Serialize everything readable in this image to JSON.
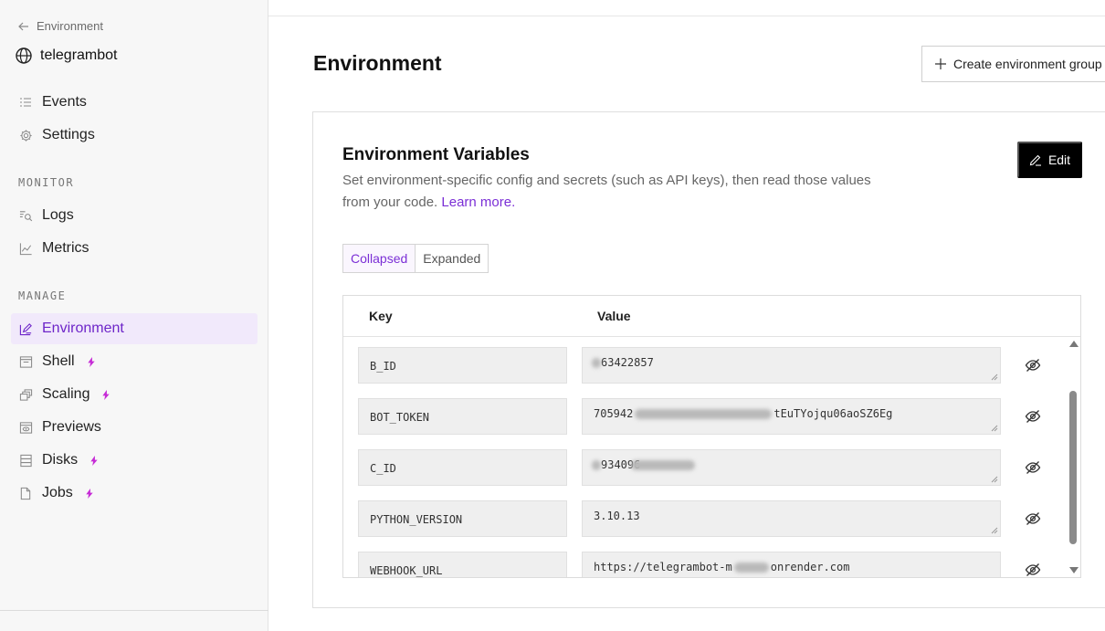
{
  "sidebar": {
    "back_label": "Environment",
    "service_name": "telegrambot",
    "top_items": [
      {
        "label": "Events",
        "icon": "list-icon"
      },
      {
        "label": "Settings",
        "icon": "gear-icon"
      }
    ],
    "monitor_title": "MONITOR",
    "monitor_items": [
      {
        "label": "Logs",
        "icon": "logs-search-icon"
      },
      {
        "label": "Metrics",
        "icon": "chart-icon"
      }
    ],
    "manage_title": "MANAGE",
    "manage_items": [
      {
        "label": "Environment",
        "icon": "environment-icon",
        "active": true,
        "bolt": false
      },
      {
        "label": "Shell",
        "icon": "terminal-icon",
        "active": false,
        "bolt": true
      },
      {
        "label": "Scaling",
        "icon": "scaling-icon",
        "active": false,
        "bolt": true
      },
      {
        "label": "Previews",
        "icon": "previews-icon",
        "active": false,
        "bolt": false
      },
      {
        "label": "Disks",
        "icon": "disk-icon",
        "active": false,
        "bolt": true
      },
      {
        "label": "Jobs",
        "icon": "jobs-icon",
        "active": false,
        "bolt": true
      }
    ],
    "bolt_color": "#c62bd6"
  },
  "header": {
    "title": "Environment",
    "create_group_label": "Create environment group"
  },
  "env_card": {
    "title": "Environment Variables",
    "description": "Set environment-specific config and secrets (such as API keys), then read those values from your code.",
    "learn_more": "Learn more.",
    "edit_label": "Edit",
    "view_modes": [
      "Collapsed",
      "Expanded"
    ],
    "active_view_mode": "Collapsed",
    "columns": {
      "key": "Key",
      "value": "Value"
    },
    "variables": [
      {
        "key": "B_ID",
        "value_prefix": "",
        "value_suffix": "63422857"
      },
      {
        "key": "BOT_TOKEN",
        "value_prefix": "705942",
        "value_suffix": "tEuTYojqu06aoSZ6Eg"
      },
      {
        "key": "C_ID",
        "value_prefix": "",
        "value_suffix": "934096"
      },
      {
        "key": "PYTHON_VERSION",
        "value_prefix": "3.10.13",
        "value_suffix": ""
      },
      {
        "key": "WEBHOOK_URL",
        "value_prefix": "https://telegrambot-m",
        "value_suffix": "onrender.com"
      }
    ]
  },
  "colors": {
    "accent": "#7b2fd6",
    "active_nav_bg": "#f1e9fb",
    "edit_button_bg": "#000000"
  }
}
